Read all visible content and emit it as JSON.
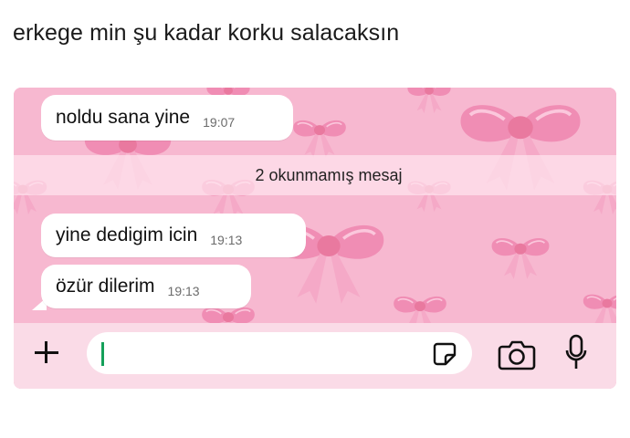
{
  "caption": "erkege min şu kadar korku salacaksın",
  "chat": {
    "messages": [
      {
        "text": "noldu sana yine",
        "time": "19:07"
      },
      {
        "text": "yine dedigim icin",
        "time": "19:13"
      },
      {
        "text": "özür dilerim",
        "time": "19:13"
      }
    ],
    "unread_banner": "2 okunmamış mesaj"
  },
  "composer": {
    "plus_icon": "plus-icon",
    "sticker_icon": "sticker-icon",
    "camera_icon": "camera-icon",
    "mic_icon": "microphone-icon",
    "cursor_color": "#14a05a"
  },
  "colors": {
    "wallpaper": "#f7b8d0",
    "bow": "#f08db4",
    "bubble": "#ffffff"
  }
}
